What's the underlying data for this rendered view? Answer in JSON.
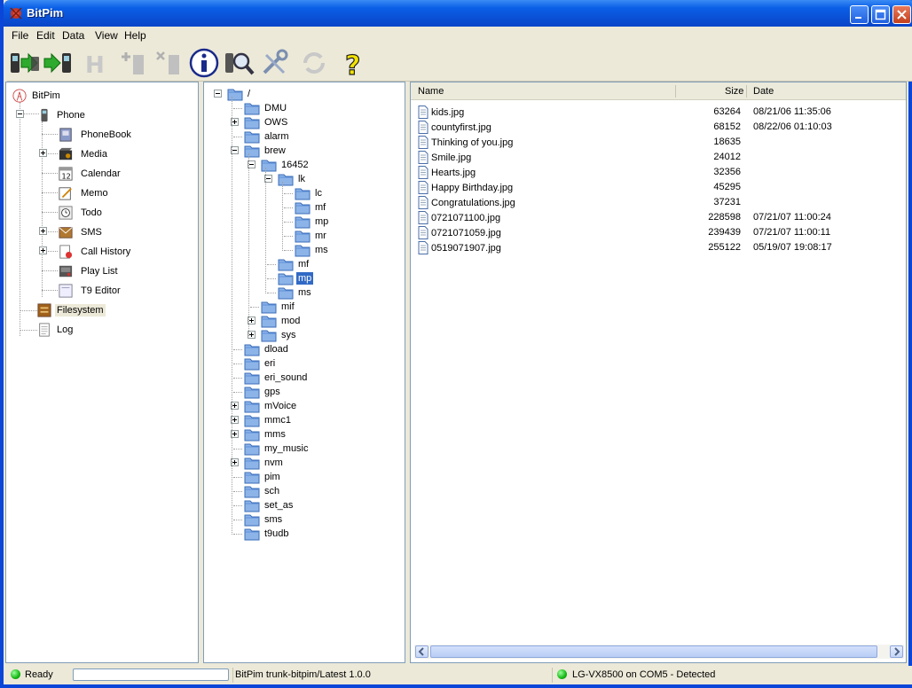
{
  "window": {
    "title": "BitPim"
  },
  "menu": [
    "File",
    "Edit",
    "Data",
    "View",
    "Help"
  ],
  "toolbar": [
    {
      "name": "get-phone-data-button",
      "icon": "phone-to-pc-icon"
    },
    {
      "name": "send-phone-data-button",
      "icon": "pc-to-phone-icon"
    },
    {
      "name": "history-button",
      "icon": "h-icon"
    },
    {
      "name": "add-entry-button",
      "icon": "add-entry-icon"
    },
    {
      "name": "delete-entry-button",
      "icon": "delete-entry-icon"
    },
    {
      "name": "info-button",
      "icon": "info-icon"
    },
    {
      "name": "phone-detect-button",
      "icon": "phone-search-icon"
    },
    {
      "name": "settings-button",
      "icon": "tools-icon"
    },
    {
      "name": "refresh-button",
      "icon": "refresh-icon"
    },
    {
      "name": "help-button",
      "icon": "help-icon"
    }
  ],
  "nav_tree": {
    "root": "BitPim",
    "phone": "Phone",
    "items": [
      "PhoneBook",
      "Media",
      "Calendar",
      "Memo",
      "Todo",
      "SMS",
      "Call History",
      "Play List",
      "T9 Editor"
    ],
    "filesystem": "Filesystem",
    "log": "Log",
    "calendar_day": "12"
  },
  "fs_tree": {
    "root": "/",
    "nodes": [
      "DMU",
      "OWS",
      "alarm",
      "brew",
      "16452",
      "lk",
      "lc",
      "mf",
      "mp",
      "mr",
      "ms",
      "mf",
      "mp",
      "ms",
      "mif",
      "mod",
      "sys",
      "dload",
      "eri",
      "eri_sound",
      "gps",
      "mVoice",
      "mmc1",
      "mms",
      "my_music",
      "nvm",
      "pim",
      "sch",
      "set_as",
      "sms",
      "t9udb"
    ],
    "selected": "mp"
  },
  "file_list": {
    "columns": {
      "name": "Name",
      "size": "Size",
      "date": "Date"
    },
    "rows": [
      {
        "name": "kids.jpg",
        "size": "63264",
        "date": "08/21/06 11:35:06"
      },
      {
        "name": "countyfirst.jpg",
        "size": "68152",
        "date": "08/22/06 01:10:03"
      },
      {
        "name": "Thinking of you.jpg",
        "size": "18635",
        "date": ""
      },
      {
        "name": "Smile.jpg",
        "size": "24012",
        "date": ""
      },
      {
        "name": "Hearts.jpg",
        "size": "32356",
        "date": ""
      },
      {
        "name": "Happy Birthday.jpg",
        "size": "45295",
        "date": ""
      },
      {
        "name": "Congratulations.jpg",
        "size": "37231",
        "date": ""
      },
      {
        "name": "0721071100.jpg",
        "size": "228598",
        "date": "07/21/07 11:00:24"
      },
      {
        "name": "0721071059.jpg",
        "size": "239439",
        "date": "07/21/07 11:00:11"
      },
      {
        "name": "0519071907.jpg",
        "size": "255122",
        "date": "05/19/07 19:08:17"
      }
    ]
  },
  "status": {
    "state": "Ready",
    "version": "BitPim trunk-bitpim/Latest 1.0.0",
    "phone": "LG-VX8500 on COM5 - Detected"
  },
  "colors": {
    "title_bar": "#0a4fd4",
    "selection": "#316ac5",
    "folder": "#8db4e8",
    "led": "#14b814"
  }
}
